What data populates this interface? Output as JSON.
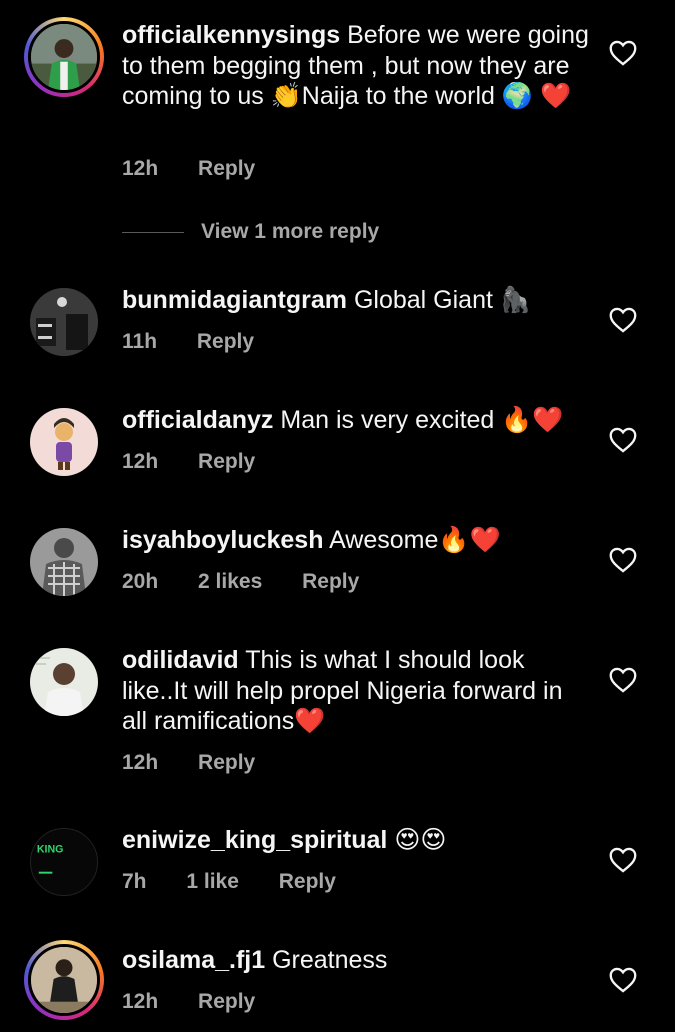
{
  "comments": [
    {
      "username": "officialkennysings",
      "text": "Before we were going to them begging them ,  but now they are coming to us 👏Naija to the world 🌍 ❤️",
      "time": "12h",
      "likes": "",
      "reply": "Reply"
    },
    {
      "username": "bunmidagiantgram",
      "text": "Global Giant 🦍",
      "time": "11h",
      "likes": "",
      "reply": "Reply"
    },
    {
      "username": "officialdanyz",
      "text": "Man is very excited 🔥❤️",
      "time": "12h",
      "likes": "",
      "reply": "Reply"
    },
    {
      "username": "isyahboyluckesh",
      "text": "Awesome🔥❤️",
      "time": "20h",
      "likes": "2 likes",
      "reply": "Reply"
    },
    {
      "username": "odilidavid",
      "text": "This is what I should look like..It will help propel Nigeria forward in all ramifications❤️",
      "time": "12h",
      "likes": "",
      "reply": "Reply"
    },
    {
      "username": "eniwize_king_spiritual",
      "text": "😍😍",
      "time": "7h",
      "likes": "1 like",
      "reply": "Reply"
    },
    {
      "username": "osilama_.fj1",
      "text": "Greatness",
      "time": "12h",
      "likes": "",
      "reply": "Reply"
    }
  ],
  "view_more": "View 1 more reply",
  "avatar_logo_text": "KING",
  "colors": {
    "background": "#000000",
    "text": "#f5f5f5",
    "muted": "#a8a8a8"
  },
  "icons": {
    "like": "heart-outline-icon"
  }
}
